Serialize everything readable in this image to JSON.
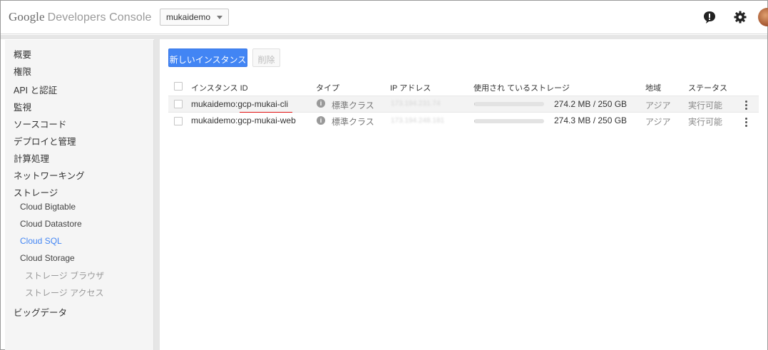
{
  "header": {
    "logo_google": "Google",
    "logo_product": "Developers Console",
    "project": "mukaidemo"
  },
  "sidebar": {
    "items": [
      {
        "label": "概要",
        "level": 0
      },
      {
        "label": "権限",
        "level": 0
      },
      {
        "label": "API と認証",
        "level": 0
      },
      {
        "label": "監視",
        "level": 0
      },
      {
        "label": "ソースコード",
        "level": 0
      },
      {
        "label": "デプロイと管理",
        "level": 0
      },
      {
        "label": "計算処理",
        "level": 0
      },
      {
        "label": "ネットワーキング",
        "level": 0
      },
      {
        "label": "ストレージ",
        "level": 0
      },
      {
        "label": "Cloud Bigtable",
        "level": 1
      },
      {
        "label": "Cloud Datastore",
        "level": 1
      },
      {
        "label": "Cloud SQL",
        "level": 1,
        "active": true
      },
      {
        "label": "Cloud Storage",
        "level": 1
      },
      {
        "label": "ストレージ ブラウザ",
        "level": 2
      },
      {
        "label": "ストレージ アクセス",
        "level": 2
      },
      {
        "label": "ビッグデータ",
        "level": 0
      }
    ]
  },
  "toolbar": {
    "new_instance_label": "新しいインスタンス",
    "delete_label": "削除"
  },
  "table": {
    "headers": {
      "id": "インスタンス ID",
      "type": "タイプ",
      "ip": "IP アドレス",
      "storage": "使用され ているストレージ",
      "region": "地域",
      "status": "ステータス"
    },
    "rows": [
      {
        "id_prefix": "mukaidemo:",
        "id_name": "gcp-mukai-cli",
        "type": "標準クラス",
        "ip": "173.194.231.74",
        "storage_fraction": 0.001,
        "storage": "274.2 MB / 250 GB",
        "region": "アジア",
        "status": "実行可能"
      },
      {
        "id_prefix": "mukaidemo:",
        "id_name": "gcp-mukai-web",
        "type": "標準クラス",
        "ip": "173.194.248.181",
        "storage_fraction": 0.001,
        "storage": "274.3 MB / 250 GB",
        "region": "アジア",
        "status": "実行可能"
      }
    ]
  },
  "colors": {
    "primary": "#4285f4",
    "active_nav": "#4285f4",
    "annotation_underline": "#e01010"
  }
}
